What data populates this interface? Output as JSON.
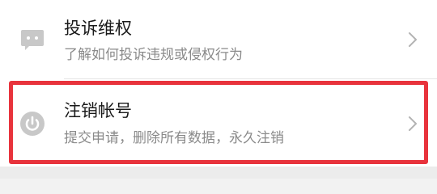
{
  "items": [
    {
      "title": "投诉维权",
      "subtitle": "了解如何投诉违规或侵权行为",
      "icon": "chat-bubble-icon"
    },
    {
      "title": "注销帐号",
      "subtitle": "提交申请，删除所有数据，永久注销",
      "icon": "power-icon"
    }
  ],
  "colors": {
    "icon": "#c8c8c8",
    "chevron": "#b3b3b3",
    "highlight": "#e8333c"
  }
}
